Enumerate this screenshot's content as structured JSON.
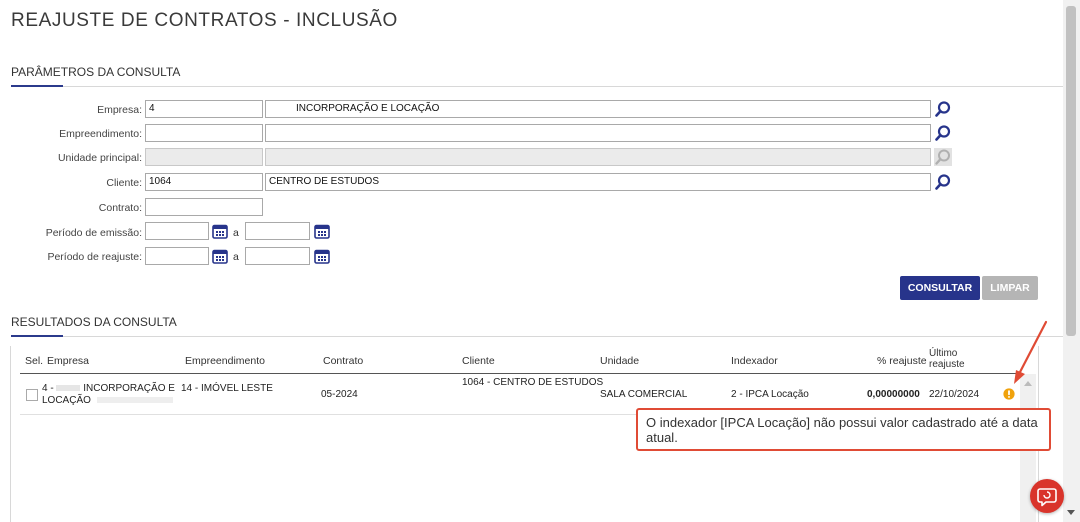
{
  "page_title": "REAJUSTE DE CONTRATOS - INCLUSÃO",
  "params": {
    "section_title": "PARÂMETROS DA CONSULTA",
    "empresa": {
      "label": "Empresa:",
      "code": "4",
      "name": "INCORPORAÇÃO E LOCAÇÃO"
    },
    "empreendimento": {
      "label": "Empreendimento:",
      "code": "",
      "name": ""
    },
    "unidade_principal": {
      "label": "Unidade principal:",
      "code": "",
      "name": ""
    },
    "cliente": {
      "label": "Cliente:",
      "code": "1064",
      "name": "CENTRO DE ESTUDOS"
    },
    "contrato": {
      "label": "Contrato:",
      "value": ""
    },
    "periodo_emissao": {
      "label": "Período de emissão:",
      "from": "",
      "sep": "a",
      "to": ""
    },
    "periodo_reajuste": {
      "label": "Período de reajuste:",
      "from": "",
      "sep": "a",
      "to": ""
    },
    "consultar_label": "CONSULTAR",
    "limpar_label": "LIMPAR"
  },
  "results": {
    "section_title": "RESULTADOS DA CONSULTA",
    "columns": {
      "sel": "Sel.",
      "empresa": "Empresa",
      "empreendimento": "Empreendimento",
      "contrato": "Contrato",
      "cliente": "Cliente",
      "unidade": "Unidade",
      "indexador": "Indexador",
      "percentual": "% reajuste",
      "ultimo": "Último reajuste"
    },
    "rows": [
      {
        "empresa_line1": "4 - ",
        "empresa_line1b": "INCORPORAÇÃO E",
        "empresa_line2": "LOCAÇÃO",
        "empreendimento": "14 - IMÓVEL LESTE",
        "contrato": "05-2024",
        "cliente": "1064 - CENTRO DE ESTUDOS",
        "unidade": "SALA COMERCIAL",
        "indexador": "2 - IPCA Locação",
        "percentual": "0,00000000",
        "ultimo": "22/10/2024"
      }
    ]
  },
  "tooltip": "O indexador [IPCA Locação] não possui valor cadastrado até a data atual.",
  "colors": {
    "accent": "#2b3a8c",
    "consultar_bg": "#27348b",
    "limpar_bg": "#b5b5b5",
    "warning": "#f0a20c",
    "highlight": "#e04b35"
  },
  "icons": {
    "lookup": "search-icon",
    "calendar": "calendar-icon",
    "warning": "warning-icon",
    "chat": "chat-icon"
  }
}
